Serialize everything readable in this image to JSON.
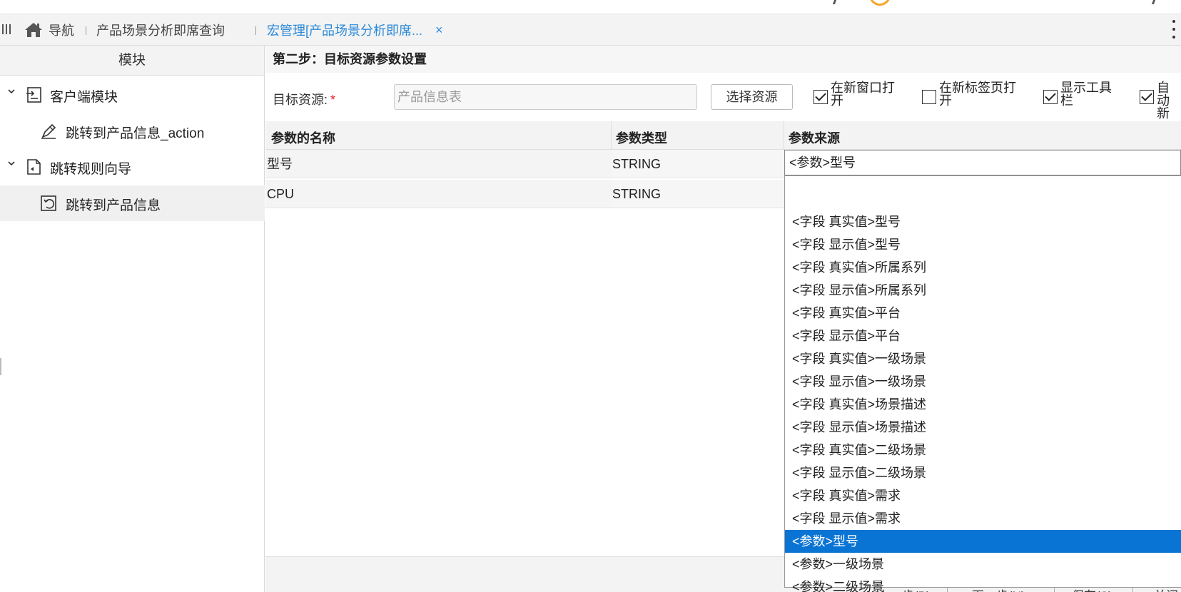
{
  "tabs": {
    "home_label": "导航",
    "tab1_label": "产品场景分析即席查询",
    "tab2_label": "宏管理[产品场景分析即席...",
    "close_label": "×"
  },
  "sidebar": {
    "header": "模块",
    "items": [
      {
        "label": "客户端模块"
      },
      {
        "label": "跳转到产品信息_action"
      },
      {
        "label": "跳转规则向导"
      },
      {
        "label": "跳转到产品信息"
      }
    ]
  },
  "main": {
    "step_title": "第二步：目标资源参数设置",
    "target_label": "目标资源:",
    "required_mark": "*",
    "target_value": "产品信息表",
    "select_button": "选择资源",
    "checkboxes": [
      {
        "label_line1": "在新窗口打",
        "label_line2": "开",
        "checked": true
      },
      {
        "label_line1": "在新标签页打",
        "label_line2": "开",
        "checked": false
      },
      {
        "label_line1": "显示工具",
        "label_line2": "栏",
        "checked": true
      },
      {
        "label_line1": "自动",
        "label_line2": "新",
        "checked": true
      }
    ]
  },
  "grid": {
    "columns": [
      "参数的名称",
      "参数类型",
      "参数来源"
    ],
    "rows": [
      {
        "name": "型号",
        "type": "STRING"
      },
      {
        "name": "CPU",
        "type": "STRING"
      }
    ]
  },
  "combo": {
    "value": "<参数>型号",
    "options": [
      "",
      "<字段 真实值>型号",
      "<字段 显示值>型号",
      "<字段 真实值>所属系列",
      "<字段 显示值>所属系列",
      "<字段 真实值>平台",
      "<字段 显示值>平台",
      "<字段 真实值>一级场景",
      "<字段 显示值>一级场景",
      "<字段 真实值>场景描述",
      "<字段 显示值>场景描述",
      "<字段 真实值>二级场景",
      "<字段 显示值>二级场景",
      "<字段 真实值>需求",
      "<字段 显示值>需求",
      "<参数>型号",
      "<参数>一级场景",
      "<参数>二级场景"
    ],
    "selected_index": 15
  },
  "footer": {
    "buttons": [
      "上一步(P)",
      "下一步(N)",
      "保存(S)",
      "关闭"
    ]
  },
  "colors": {
    "accent": "#2b8ad8",
    "selection": "#0a74d4",
    "required": "#e02020"
  }
}
